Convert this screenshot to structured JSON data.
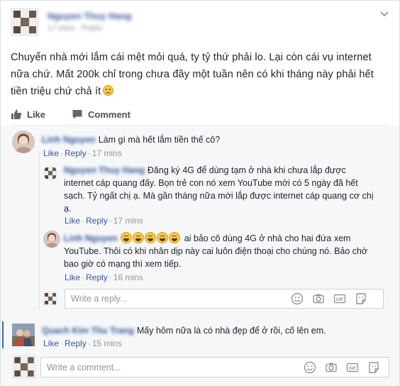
{
  "post": {
    "author": "Nguyen Thuy Hang",
    "meta": "17 mins · Public",
    "text": "Chuyển nhà mới lắm cái mệt mỏi quá, ty tỷ thứ phải lo. Lại còn cái vụ internet nữa chứ. Mất 200k chỉ trong chưa đầy một tuần nên có khi tháng này phải hết tiền triệu chứ chả ít",
    "text_emoji": "sad-emoji"
  },
  "actions": {
    "like": "Like",
    "comment": "Comment"
  },
  "comments": [
    {
      "name": "Linh Nguyen",
      "text": "Làm gì mà hết lắm tiền thế cô?",
      "like": "Like",
      "reply": "Reply",
      "time": "17 mins",
      "replies": [
        {
          "name": "Nguyen Thuy Hang",
          "text": "Đăng ký 4G để dùng tạm ở nhà khi chưa lắp được internet cáp quang đấy. Bọn trẻ con nó xem YouTube mới có 5 ngày đã hết sạch. Tỷ ngất chị ạ. Mà gần tháng nữa mới lắp được internet cáp quang cơ chị ạ.",
          "like": "Like",
          "reply": "Reply",
          "time": "17 mins"
        },
        {
          "name": "Linh Nguyen",
          "text": "ai bảo cô dùng 4G ở nhà cho hai đứa xem YouTube. Thôi có khi nhân dịp này cai luôn điện thoại cho chúng nó. Bảo chờ bao giờ có mạng thì xem tiếp.",
          "emoji": [
            "laugh",
            "laugh",
            "laugh",
            "laugh",
            "laugh"
          ],
          "like": "Like",
          "reply": "Reply",
          "time": "16 mins"
        }
      ],
      "reply_placeholder": "Write a reply..."
    },
    {
      "name": "Quach Kim Thu Trang",
      "text": "Mấy hôm nữa là có nhà đẹp để ở rồi, cố lên em.",
      "like": "Like",
      "reply": "Reply",
      "time": "15 mins"
    }
  ],
  "comment_placeholder": "Write a comment...",
  "box_icons": [
    "emoji-icon",
    "camera-icon",
    "gif-icon",
    "sticker-icon"
  ],
  "colors": {
    "link": "#365899",
    "text": "#1d2129",
    "muted": "#90949c",
    "bg": "#f6f7f9",
    "accent": "#4267b2"
  }
}
